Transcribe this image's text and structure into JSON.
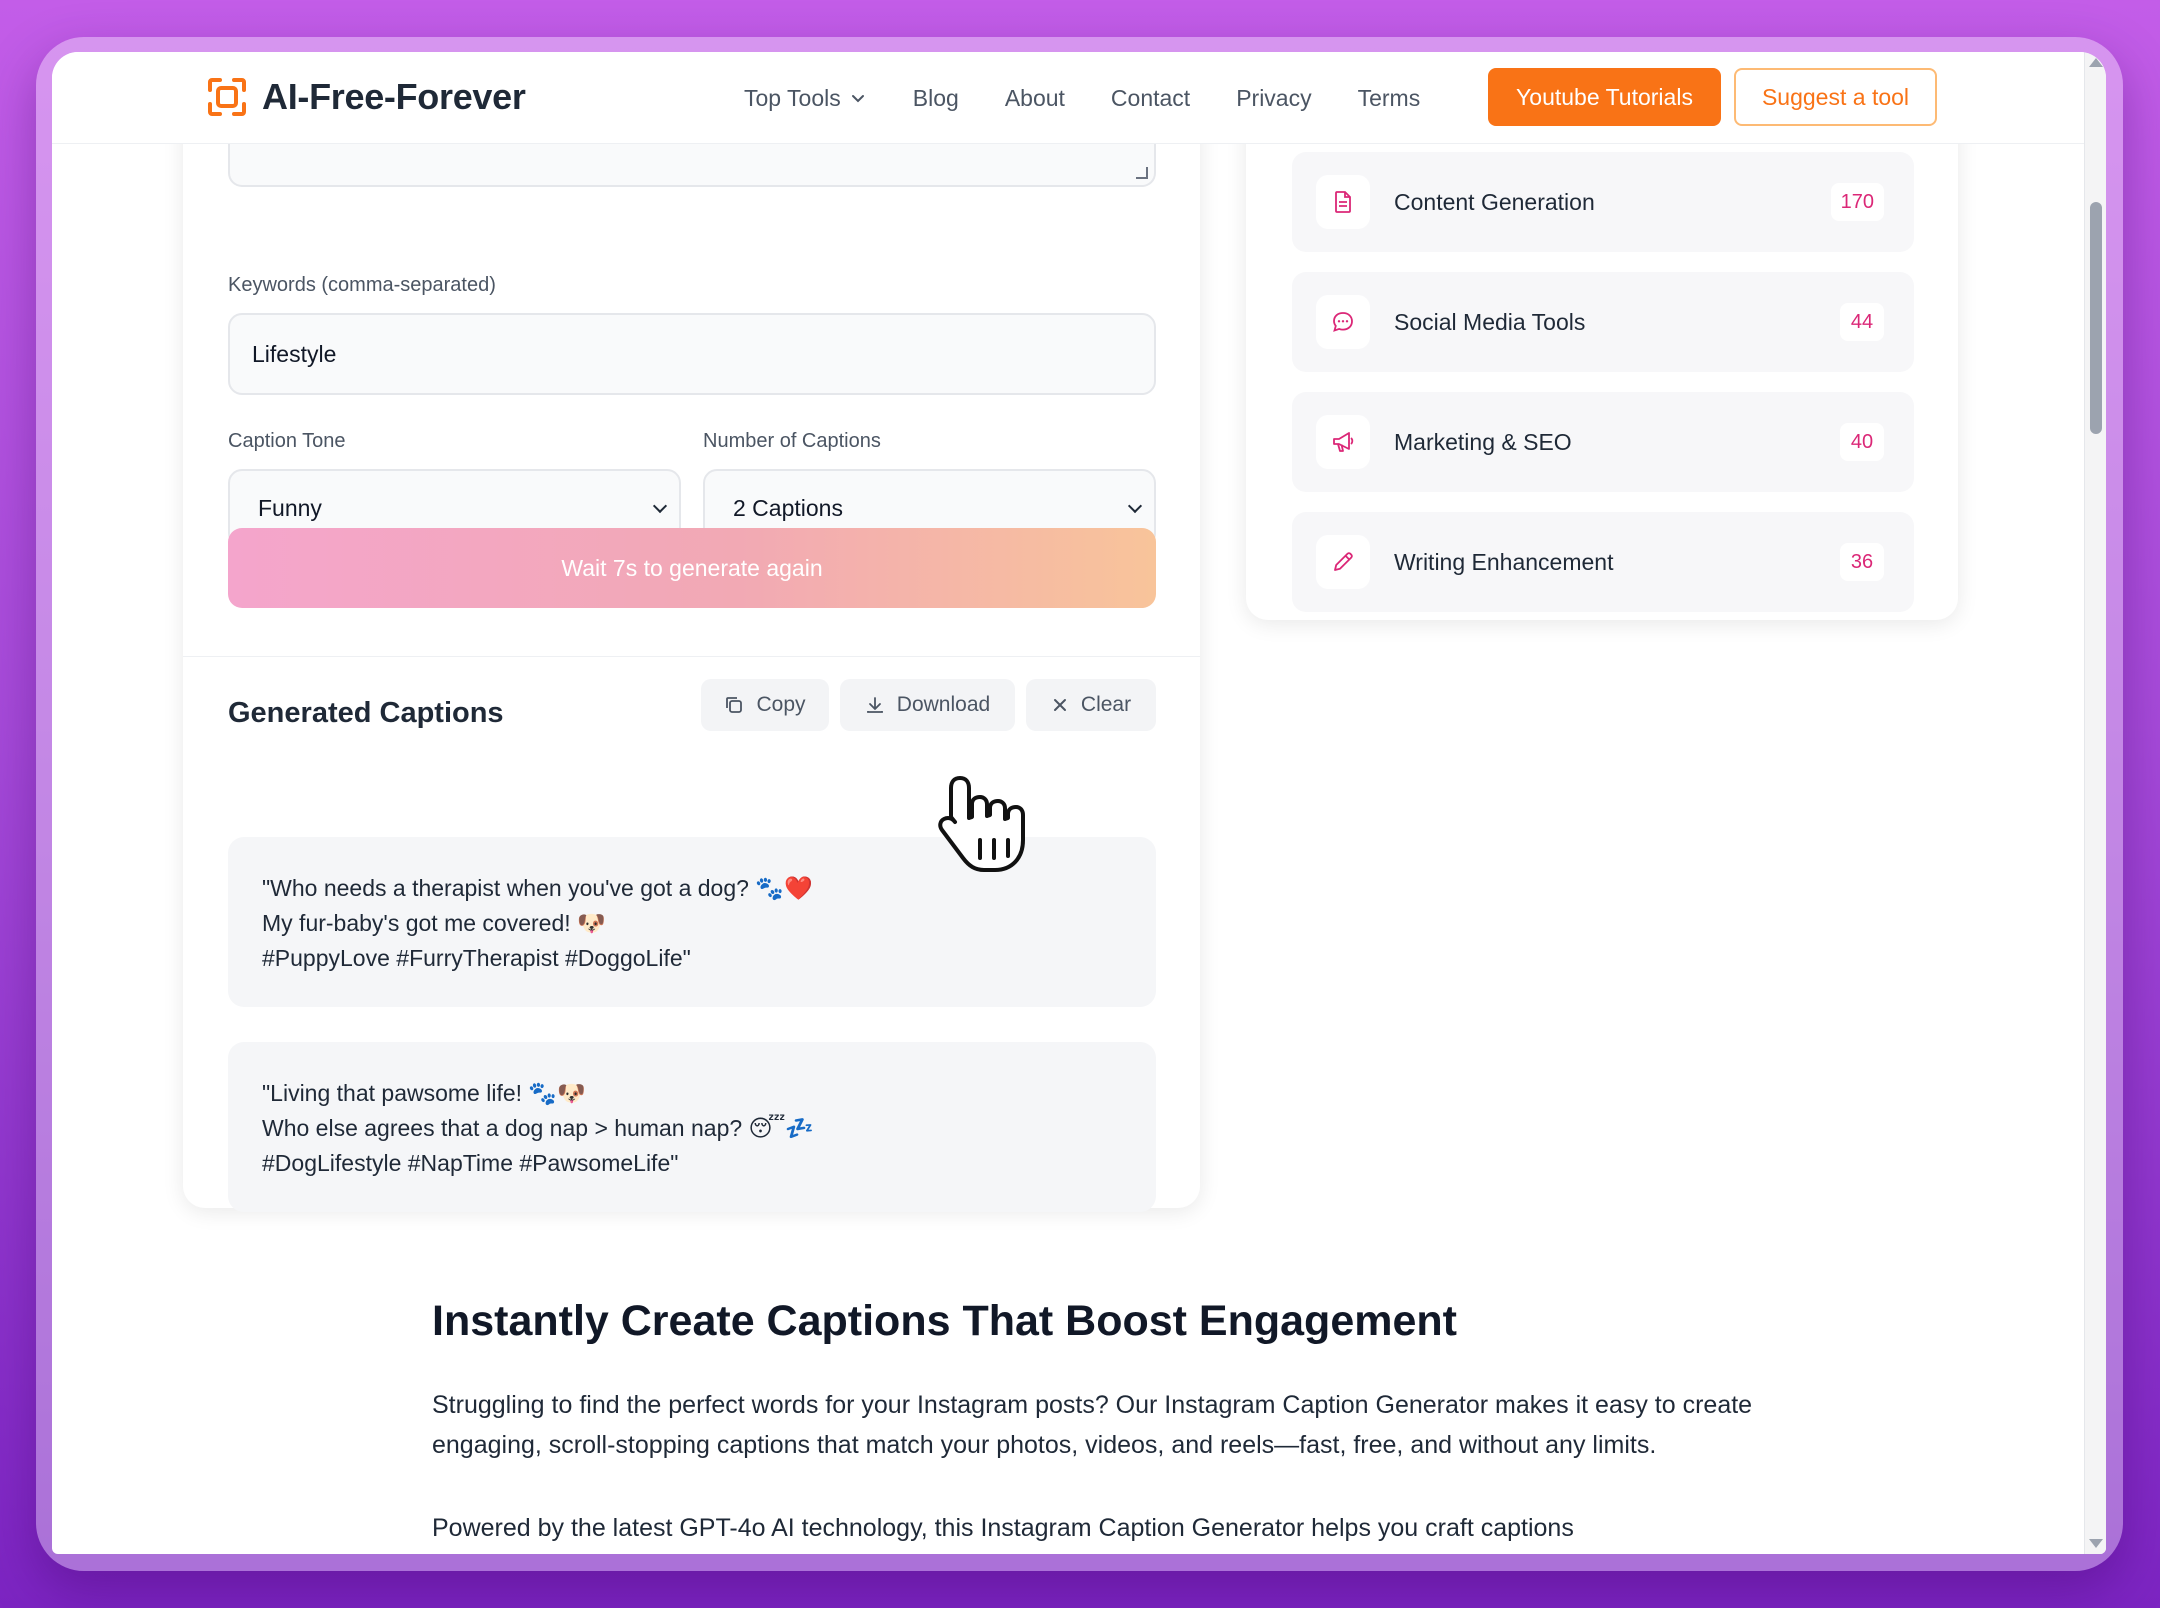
{
  "header": {
    "logo_text": "AI-Free-Forever",
    "nav": [
      "Top Tools",
      "Blog",
      "About",
      "Contact",
      "Privacy",
      "Terms"
    ],
    "youtube_button": "Youtube Tutorials",
    "suggest_button": "Suggest a tool"
  },
  "form": {
    "keywords_label": "Keywords (comma-separated)",
    "keywords_value": "Lifestyle",
    "tone_label": "Caption Tone",
    "tone_value": "Funny",
    "count_label": "Number of Captions",
    "count_value": "2 Captions",
    "generate_button": "Wait 7s to generate again"
  },
  "results": {
    "title": "Generated Captions",
    "copy_label": "Copy",
    "download_label": "Download",
    "clear_label": "Clear",
    "captions": [
      [
        "\"Who needs a therapist when you've got a dog? 🐾❤️",
        "My fur-baby's got me covered! 🐶",
        "#PuppyLove #FurryTherapist #DoggoLife\""
      ],
      [
        "\"Living that pawsome life! 🐾🐶",
        "Who else agrees that a dog nap > human nap? 😴💤",
        "#DogLifestyle #NapTime #PawsomeLife\""
      ]
    ]
  },
  "sidebar": {
    "categories": [
      {
        "label": "Content Generation",
        "count": "170",
        "icon": "document-icon"
      },
      {
        "label": "Social Media Tools",
        "count": "44",
        "icon": "chat-bubble-icon"
      },
      {
        "label": "Marketing & SEO",
        "count": "40",
        "icon": "megaphone-icon"
      },
      {
        "label": "Writing Enhancement",
        "count": "36",
        "icon": "pencil-icon"
      }
    ]
  },
  "article": {
    "heading": "Instantly Create Captions That Boost Engagement",
    "paragraph1": "Struggling to find the perfect words for your Instagram posts? Our Instagram Caption Generator makes it easy to create engaging, scroll-stopping captions that match your photos, videos, and reels—fast, free, and without any limits.",
    "paragraph2": "Powered by the latest GPT-4o AI technology, this Instagram Caption Generator helps you craft captions"
  },
  "colors": {
    "accent_orange": "#f97316",
    "pink_count": "#db2777",
    "background_purple": "#a64ad9"
  }
}
